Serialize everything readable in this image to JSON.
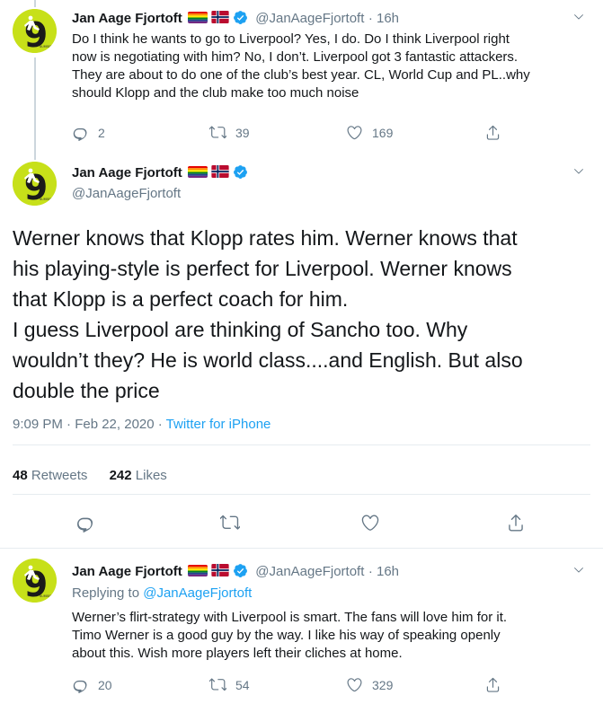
{
  "tweet1": {
    "name": "Jan Aage Fjortoft",
    "handle": "@JanAageFjortoft",
    "time": "16h",
    "text": "Do I think he wants to go to Liverpool? Yes, I do. Do I think Liverpool right\nnow is negotiating with him? No, I don’t. Liverpool got 3 fantastic attackers.\nThey are about to do one of the club’s best year. CL, World Cup and PL..why\nshould Klopp and the club make too much noise",
    "replies": "2",
    "retweets": "39",
    "likes": "169"
  },
  "main": {
    "name": "Jan Aage Fjortoft",
    "handle": "@JanAageFjortoft",
    "text": "Werner knows that Klopp rates him. Werner knows that\nhis playing-style is perfect for Liverpool. Werner knows\nthat Klopp is a perfect coach for him.\nI guess Liverpool are thinking of Sancho too. Why\nwouldn’t they? He is world class....and English. But also\ndouble the price",
    "timestamp": "9:09 PM · Feb 22, 2020 · ",
    "app": "Twitter for iPhone",
    "retweet_count": "48",
    "retweet_label": "Retweets",
    "like_count": "242",
    "like_label": "Likes"
  },
  "tweet3": {
    "name": "Jan Aage Fjortoft",
    "handle": "@JanAageFjortoft",
    "time": "16h",
    "replying_label": "Replying to ",
    "replying_handle": "@JanAageFjortoft",
    "text": "Werner’s flirt-strategy with Liverpool is smart. The fans will love him for it.\nTimo Werner is a good guy by the way. I like his way of speaking openly\nabout this. Wish more players left their cliches at home.",
    "replies": "20",
    "retweets": "54",
    "likes": "329"
  },
  "colors": {
    "accent": "#1da1f2",
    "secondary_text": "#657786",
    "avatar_bg": "#c7e019"
  },
  "icons": [
    "reply-icon",
    "retweet-icon",
    "like-icon",
    "share-icon",
    "verified-icon",
    "chevron-down-icon",
    "rainbow-flag-icon",
    "norway-flag-icon"
  ]
}
